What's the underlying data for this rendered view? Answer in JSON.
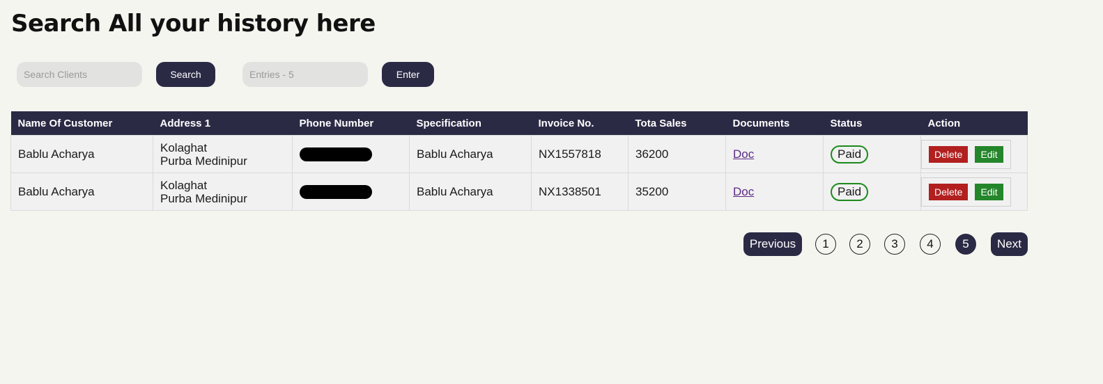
{
  "page_title": "Search All your history here",
  "search": {
    "placeholder": "Search Clients",
    "button": "Search"
  },
  "entries": {
    "placeholder": "Entries - 5",
    "button": "Enter"
  },
  "table": {
    "headers": [
      "Name Of Customer",
      "Address 1",
      "Phone Number",
      "Specification",
      "Invoice No.",
      "Tota Sales",
      "Documents",
      "Status",
      "Action"
    ],
    "rows": [
      {
        "name": "Bablu Acharya",
        "address_line1": "Kolaghat",
        "address_line2": "Purba Medinipur",
        "phone": "[redacted]",
        "specification": "Bablu Acharya",
        "invoice": "NX1557818",
        "sales": "36200",
        "document": "Doc",
        "status": "Paid",
        "delete": "Delete",
        "edit": "Edit"
      },
      {
        "name": "Bablu Acharya",
        "address_line1": "Kolaghat",
        "address_line2": "Purba Medinipur",
        "phone": "[redacted]",
        "specification": "Bablu Acharya",
        "invoice": "NX1338501",
        "sales": "35200",
        "document": "Doc",
        "status": "Paid",
        "delete": "Delete",
        "edit": "Edit"
      }
    ]
  },
  "pagination": {
    "previous": "Previous",
    "next": "Next",
    "pages": [
      "1",
      "2",
      "3",
      "4",
      "5"
    ],
    "current": "5"
  },
  "colors": {
    "primary": "#2b2a45",
    "delete": "#b21f1f",
    "edit": "#24862a",
    "paid_border": "#1c8a1c",
    "background": "#f5f5f0"
  }
}
